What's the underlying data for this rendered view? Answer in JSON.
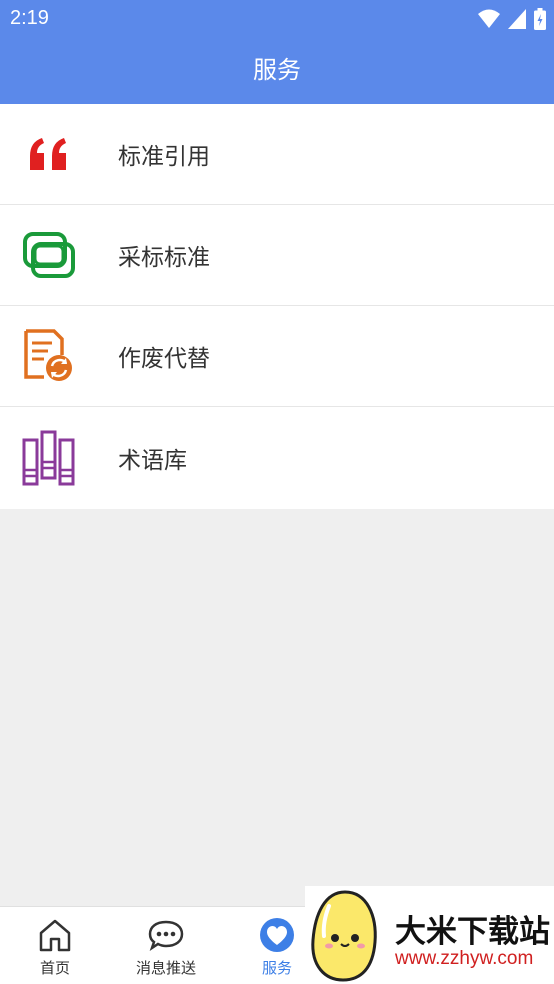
{
  "status_bar": {
    "time": "2:19"
  },
  "app_bar": {
    "title": "服务"
  },
  "services": [
    {
      "label": "标准引用",
      "icon": "quote-icon",
      "color": "#e02020"
    },
    {
      "label": "采标标准",
      "icon": "overlap-squares-icon",
      "color": "#1a9a3a"
    },
    {
      "label": "作废代替",
      "icon": "document-refresh-icon",
      "color": "#e07020"
    },
    {
      "label": "术语库",
      "icon": "books-icon",
      "color": "#8a3a9a"
    }
  ],
  "bottom_nav": {
    "home": "首页",
    "messages": "消息推送",
    "services": "服务"
  },
  "watermark": {
    "title": "大米下载站",
    "url": "www.zzhyw.com"
  },
  "colors": {
    "primary": "#5b89ea",
    "active_tab": "#3d7fe6"
  }
}
